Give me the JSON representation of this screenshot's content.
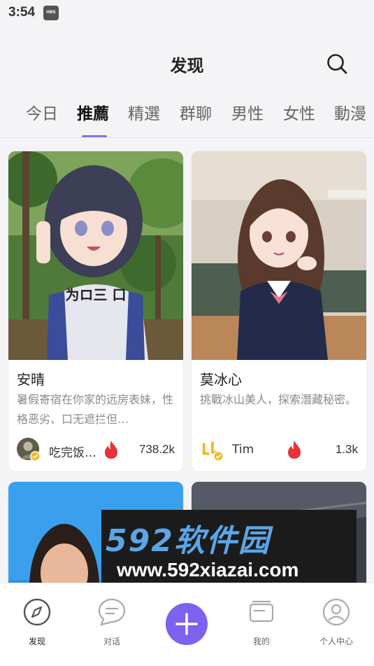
{
  "status_bar": {
    "time": "3:54",
    "badge": "HMS"
  },
  "header": {
    "title": "发现",
    "search_icon": "search-icon"
  },
  "tabs": [
    {
      "label": "今日"
    },
    {
      "label": "推薦"
    },
    {
      "label": "精選"
    },
    {
      "label": "群聊"
    },
    {
      "label": "男性"
    },
    {
      "label": "女性"
    },
    {
      "label": "動漫"
    }
  ],
  "active_tab": "推薦",
  "cards": [
    {
      "name": "安晴",
      "desc": "暑假寄宿在你家的远房表妹，性格恶劣、口无遮拦但…",
      "author": "吃完饭…",
      "heat": "738.2k",
      "shirt_text": "为ロ三 口"
    },
    {
      "name": "莫冰心",
      "desc": "挑戰冰山美人，探索潛藏秘密。",
      "author": "Tim",
      "heat": "1.3k"
    }
  ],
  "watermark": {
    "line1": "592软件园",
    "line2": "www.592xiazai.com"
  },
  "bottom_nav": [
    {
      "label": "发现",
      "icon": "compass-icon"
    },
    {
      "label": "对话",
      "icon": "chat-bubble-icon"
    },
    {
      "label": "",
      "icon": "plus-icon"
    },
    {
      "label": "我的",
      "icon": "cards-icon"
    },
    {
      "label": "个人中心",
      "icon": "user-icon"
    }
  ],
  "colors": {
    "accent": "#7c62ee",
    "fire": "#e8313a",
    "verified": "#f5b81e"
  }
}
